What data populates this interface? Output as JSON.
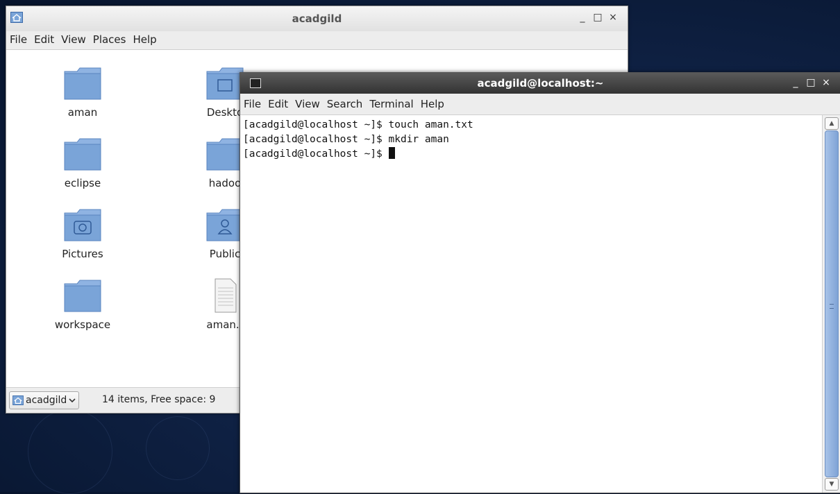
{
  "file_manager": {
    "title": "acadgild",
    "menu": [
      "File",
      "Edit",
      "View",
      "Places",
      "Help"
    ],
    "items": [
      {
        "label": "aman",
        "icon": "folder"
      },
      {
        "label": "Deskto",
        "icon": "desktop-folder"
      },
      {
        "label": "eclipse",
        "icon": "folder"
      },
      {
        "label": "hadoo",
        "icon": "folder"
      },
      {
        "label": "Pictures",
        "icon": "pictures-folder"
      },
      {
        "label": "Public",
        "icon": "public-folder"
      },
      {
        "label": "workspace",
        "icon": "folder"
      },
      {
        "label": "aman.t",
        "icon": "text-file"
      }
    ],
    "location": "acadgild",
    "status": "14 items, Free space: 9"
  },
  "terminal": {
    "title": "acadgild@localhost:~",
    "menu": [
      "File",
      "Edit",
      "View",
      "Search",
      "Terminal",
      "Help"
    ],
    "lines": [
      "[acadgild@localhost ~]$ touch aman.txt",
      "[acadgild@localhost ~]$ mkdir aman",
      "[acadgild@localhost ~]$ "
    ]
  },
  "window_controls": {
    "minimize": "_",
    "maximize": "□",
    "close": "×"
  },
  "colors": {
    "folder": "#7aa4d8",
    "folder_tab": "#8fb3e2",
    "desktop_bg": "#102347",
    "terminal_titlebar": "#3c3c3c"
  }
}
